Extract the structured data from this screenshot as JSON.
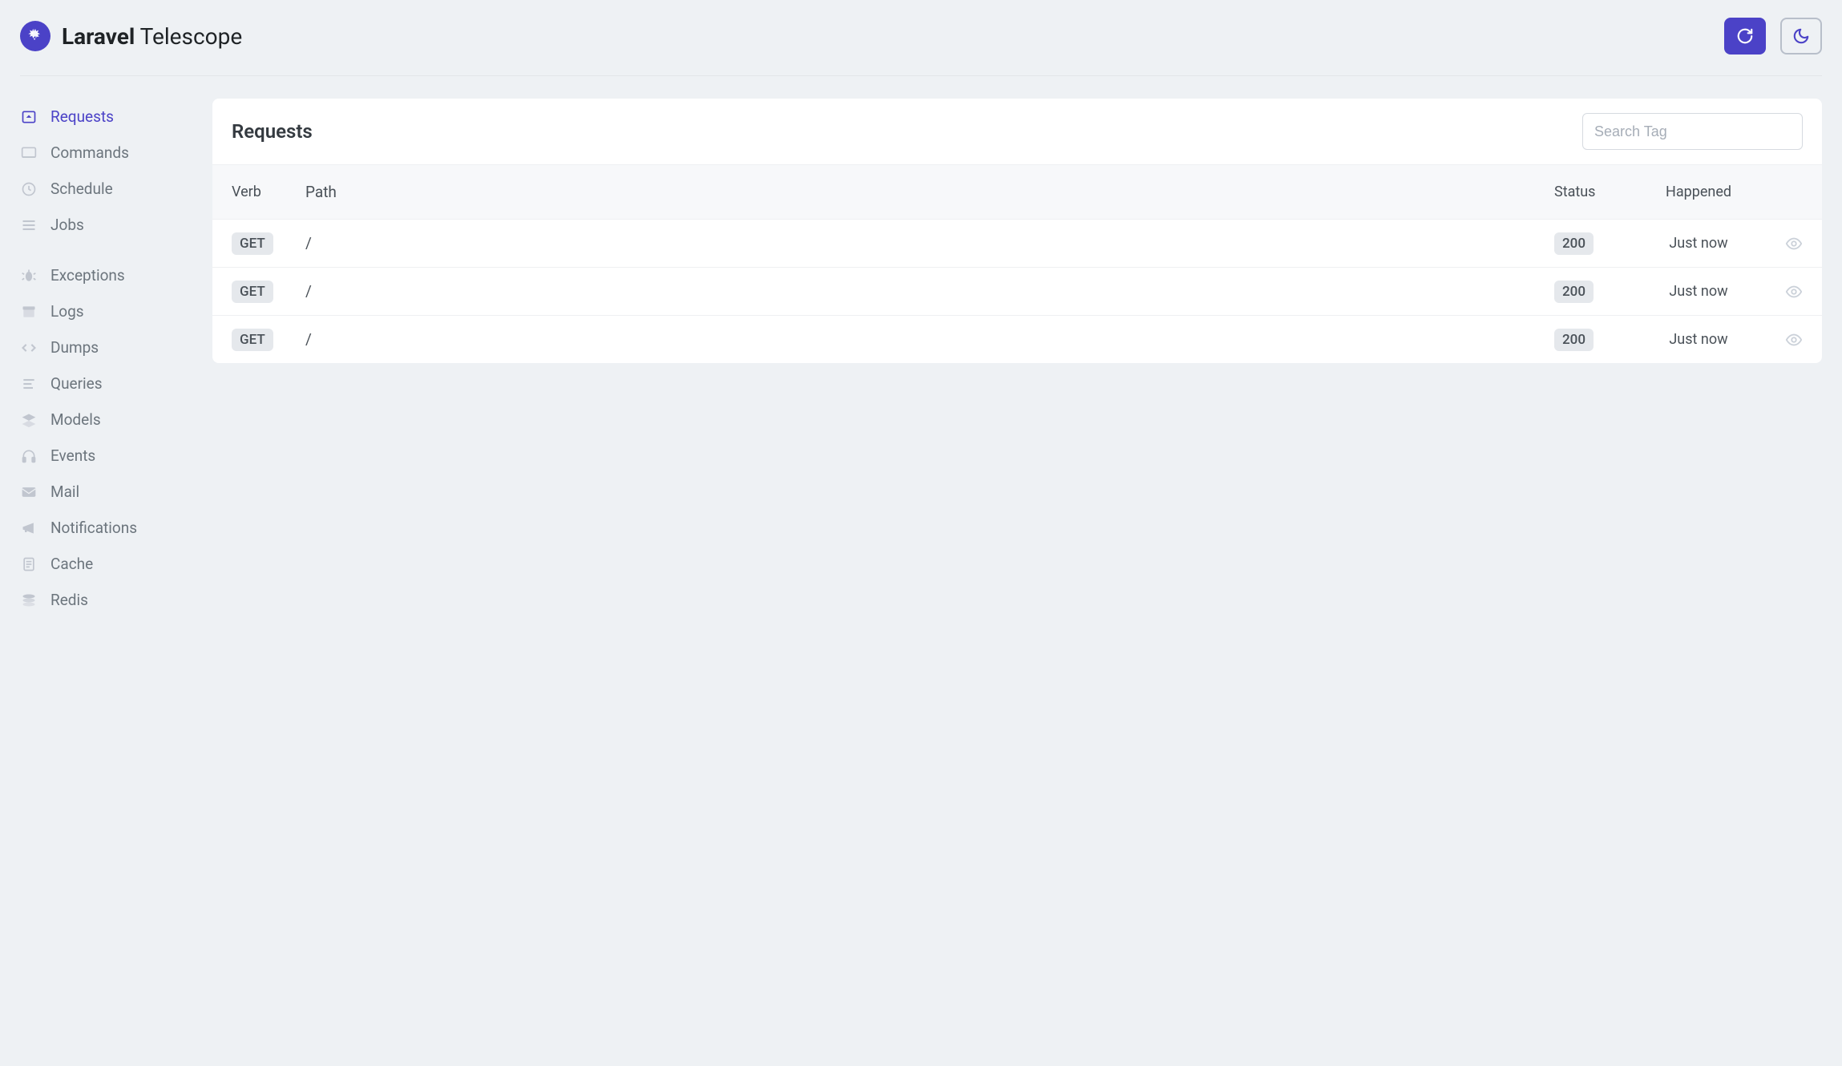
{
  "brand": {
    "strong": "Laravel",
    "rest": "Telescope"
  },
  "search": {
    "placeholder": "Search Tag"
  },
  "colors": {
    "primary": "#4b42c7"
  },
  "sidebar": {
    "group1": [
      {
        "label": "Requests",
        "active": true
      },
      {
        "label": "Commands",
        "active": false
      },
      {
        "label": "Schedule",
        "active": false
      },
      {
        "label": "Jobs",
        "active": false
      }
    ],
    "group2": [
      {
        "label": "Exceptions",
        "active": false
      },
      {
        "label": "Logs",
        "active": false
      },
      {
        "label": "Dumps",
        "active": false
      },
      {
        "label": "Queries",
        "active": false
      },
      {
        "label": "Models",
        "active": false
      },
      {
        "label": "Events",
        "active": false
      },
      {
        "label": "Mail",
        "active": false
      },
      {
        "label": "Notifications",
        "active": false
      },
      {
        "label": "Cache",
        "active": false
      },
      {
        "label": "Redis",
        "active": false
      }
    ]
  },
  "page": {
    "title": "Requests",
    "columns": {
      "verb": "Verb",
      "path": "Path",
      "status": "Status",
      "happened": "Happened"
    },
    "rows": [
      {
        "verb": "GET",
        "path": "/",
        "status": "200",
        "happened": "Just now"
      },
      {
        "verb": "GET",
        "path": "/",
        "status": "200",
        "happened": "Just now"
      },
      {
        "verb": "GET",
        "path": "/",
        "status": "200",
        "happened": "Just now"
      }
    ]
  }
}
